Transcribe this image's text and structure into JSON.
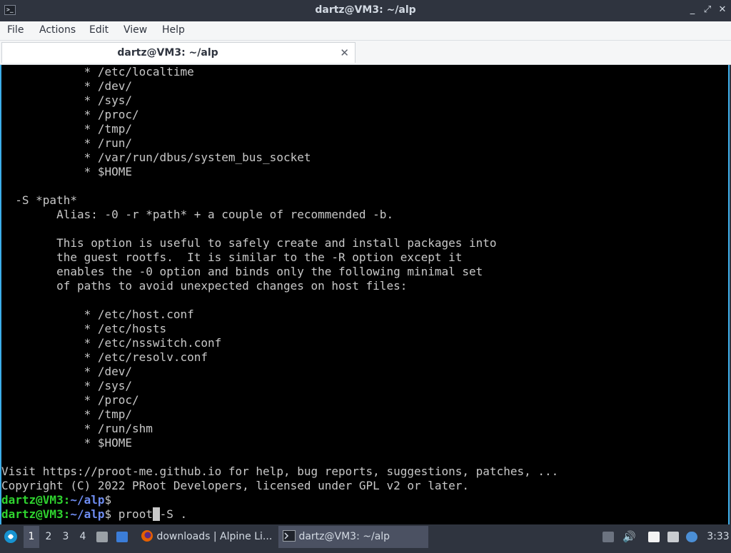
{
  "window": {
    "title": "dartz@VM3: ~/alp",
    "app_icon_glyph": ">_",
    "controls": [
      "_",
      "⤢",
      "✕"
    ]
  },
  "menu": [
    "File",
    "Actions",
    "Edit",
    "View",
    "Help"
  ],
  "tab": {
    "label": "dartz@VM3: ~/alp",
    "close_glyph": "✕"
  },
  "terminal": {
    "lines": [
      "            * /etc/localtime",
      "            * /dev/",
      "            * /sys/",
      "            * /proc/",
      "            * /tmp/",
      "            * /run/",
      "            * /var/run/dbus/system_bus_socket",
      "            * $HOME",
      "",
      "  -S *path*",
      "        Alias: -0 -r *path* + a couple of recommended -b.",
      "",
      "        This option is useful to safely create and install packages into",
      "        the guest rootfs.  It is similar to the -R option except it",
      "        enables the -0 option and binds only the following minimal set",
      "        of paths to avoid unexpected changes on host files:",
      "",
      "            * /etc/host.conf",
      "            * /etc/hosts",
      "            * /etc/nsswitch.conf",
      "            * /etc/resolv.conf",
      "            * /dev/",
      "            * /sys/",
      "            * /proc/",
      "            * /tmp/",
      "            * /run/shm",
      "            * $HOME",
      "",
      "Visit https://proot-me.github.io for help, bug reports, suggestions, patches, ...",
      "Copyright (C) 2022 PRoot Developers, licensed under GPL v2 or later."
    ],
    "prompt_user": "dartz@VM3",
    "prompt_sep": ":",
    "prompt_path": "~/alp",
    "prompt_end": "$",
    "command_before_cursor": " proot",
    "cursor_char": " ",
    "command_after_cursor": "-S ."
  },
  "taskbar": {
    "workspaces": [
      "1",
      "2",
      "3",
      "4"
    ],
    "active_workspace": "1",
    "tasks": [
      {
        "label": "downloads | Alpine Li...",
        "icon": "firefox-icon"
      },
      {
        "label": "dartz@VM3: ~/alp",
        "icon": "terminal-icon"
      }
    ],
    "clock": "3:33"
  },
  "colors": {
    "prompt_user": "#2fd42f",
    "prompt_path": "#6e8cf0",
    "terminal_bg": "#000000",
    "accent": "#3daee9"
  }
}
